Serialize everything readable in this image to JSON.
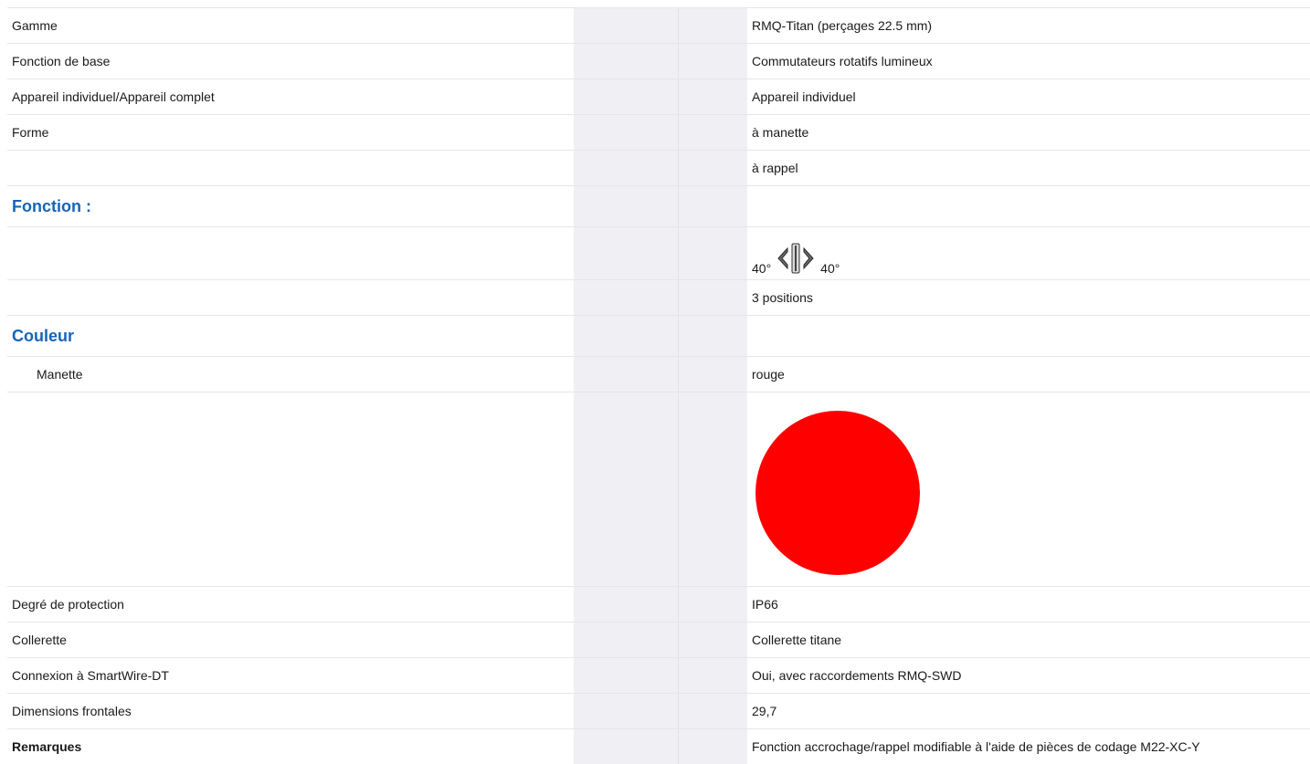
{
  "rows": [
    {
      "label": "Gamme",
      "value": "RMQ-Titan (perçages 22.5 mm)"
    },
    {
      "label": "Fonction de base",
      "value": "Commutateurs rotatifs lumineux"
    },
    {
      "label": "Appareil individuel/Appareil complet",
      "value": "Appareil individuel"
    },
    {
      "label": "Forme",
      "value": "à manette"
    },
    {
      "label": "",
      "value": "à rappel"
    }
  ],
  "section_fonction": "Fonction :",
  "rotation": {
    "left_angle": "40°",
    "right_angle": "40°",
    "icon": "rotary-switch-return-icon"
  },
  "positions": "3 positions",
  "section_couleur": "Couleur",
  "manette": {
    "label": "Manette",
    "value": "rouge",
    "swatch_color": "#ff0000"
  },
  "rows2": [
    {
      "label": "Degré de protection",
      "value": "IP66"
    },
    {
      "label": "Collerette",
      "value": "Collerette titane"
    },
    {
      "label": "Connexion à SmartWire-DT",
      "value": "Oui, avec raccordements RMQ-SWD"
    },
    {
      "label": "Dimensions frontales",
      "value": "29,7"
    }
  ],
  "remarques": {
    "label": "Remarques",
    "value": "Fonction accrochage/rappel modifiable à l'aide de pièces de codage M22-XC-Y"
  }
}
